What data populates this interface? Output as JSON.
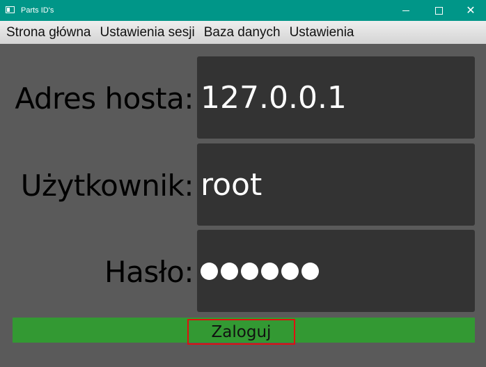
{
  "window": {
    "title": "Parts ID's",
    "icon": "window-icon",
    "controls": {
      "minimize": "minimize-icon",
      "maximize": "maximize-icon",
      "close": "✕"
    }
  },
  "menu": {
    "items": [
      {
        "label": "Strona główna"
      },
      {
        "label": "Ustawienia sesji"
      },
      {
        "label": "Baza danych"
      },
      {
        "label": "Ustawienia"
      }
    ]
  },
  "form": {
    "host": {
      "label": "Adres hosta:",
      "value": "127.0.0.1"
    },
    "user": {
      "label": "Użytkownik:",
      "value": "root"
    },
    "password": {
      "label": "Hasło:",
      "masked_length": 6
    },
    "login_button": {
      "label": "Zaloguj"
    }
  },
  "colors": {
    "titlebar": "#009688",
    "background": "#5a5a5a",
    "field": "#333333",
    "login": "#339933",
    "highlight": "#e01010"
  }
}
